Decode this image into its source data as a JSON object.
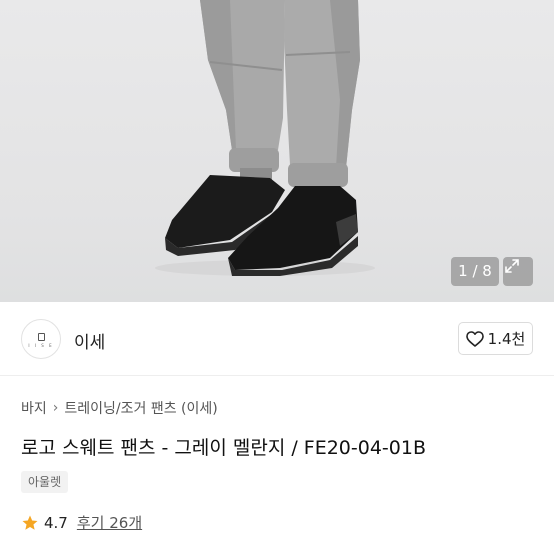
{
  "gallery": {
    "counter": "1 / 8",
    "expand_icon": "expand-icon",
    "background": "#e6e6e7"
  },
  "shop": {
    "logo_word": "I I S E",
    "name": "이세",
    "like_icon": "heart-outline-icon",
    "like_count": "1.4천"
  },
  "product": {
    "breadcrumb": [
      "바지",
      "트레이닝/조거 팬츠 (이세)"
    ],
    "title": "로고 스웨트 팬츠 - 그레이 멜란지 / FE20-04-01B",
    "tag": "아울렛",
    "rating_icon": "star-icon",
    "rating": "4.7",
    "reviews": "후기 26개",
    "star_color": "#f5a623"
  }
}
